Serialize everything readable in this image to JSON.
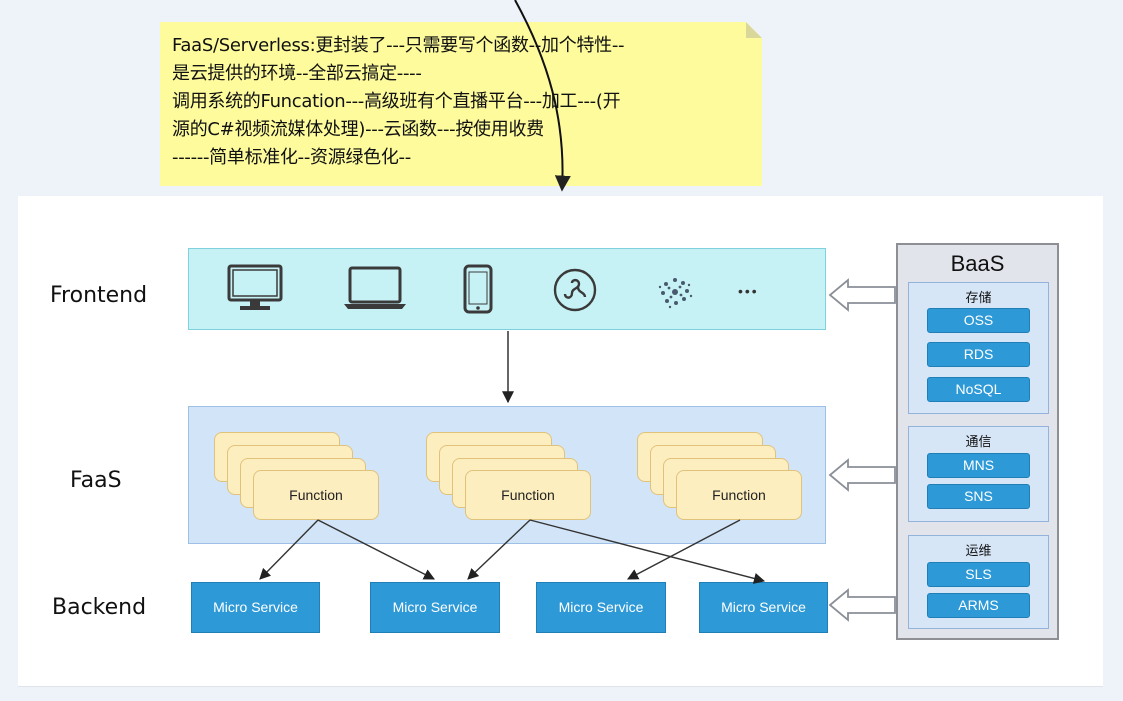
{
  "note": {
    "lines": [
      "FaaS/Serverless:更封装了---只需要写个函数--加个特性--",
      "是云提供的环境--全部云搞定----",
      "调用系统的Funcation---高级班有个直播平台---加工---(开",
      "源的C#视频流媒体处理)---云函数---按使用收费",
      "------简单标准化--资源绿色化--"
    ]
  },
  "rows": {
    "frontend": "Frontend",
    "faas": "FaaS",
    "backend": "Backend"
  },
  "frontend_icons": [
    "monitor-icon",
    "laptop-icon",
    "phone-icon",
    "mini-program-icon",
    "sparkle-logo-icon",
    "more-dots-icon"
  ],
  "more_text": "•••",
  "functions": [
    "Function",
    "Function",
    "Function"
  ],
  "micro_services": [
    "Micro Service",
    "Micro Service",
    "Micro Service",
    "Micro Service"
  ],
  "baas": {
    "title": "BaaS",
    "groups": [
      {
        "label": "存储",
        "items": [
          "OSS",
          "RDS",
          "NoSQL"
        ]
      },
      {
        "label": "通信",
        "items": [
          "MNS",
          "SNS"
        ]
      },
      {
        "label": "运维",
        "items": [
          "SLS",
          "ARMS"
        ]
      }
    ]
  },
  "colors": {
    "note": "#fdfb9c",
    "frontend_band": "#c7f2f5",
    "faas_band": "#d2e4f8",
    "function_card": "#fdeec0",
    "service_blue": "#2d99d6",
    "baas_panel": "#e1e4ea"
  }
}
